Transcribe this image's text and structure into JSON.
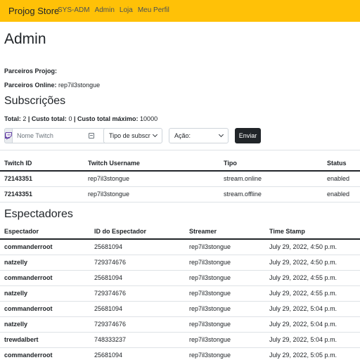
{
  "navbar": {
    "brand": "Projog Store",
    "links": [
      "SYS-ADM",
      "Admin",
      "Loja",
      "Meu Perfil"
    ]
  },
  "page": {
    "title": "Admin"
  },
  "partners": {
    "projog_label": "Parceiros Projog:",
    "online_label": "Parceiros Online:",
    "online_value": "rep7il3stongue"
  },
  "subscriptions": {
    "heading": "Subscrições",
    "total_label": "Total:",
    "total_value": "2",
    "cost_label": "Custo total:",
    "cost_value": "0",
    "max_cost_label": "Custo total máximo:",
    "max_cost_value": "10000",
    "separator": "|",
    "form": {
      "twitch_placeholder": "Nome Twitch",
      "type_select": "Tipo de subscr",
      "action_select": "Ação:",
      "submit_label": "Enviar"
    },
    "table": {
      "headers": [
        "Twitch ID",
        "Twitch Username",
        "Tipo",
        "Status"
      ],
      "rows": [
        [
          "72143351",
          "rep7il3stongue",
          "stream.online",
          "enabled"
        ],
        [
          "72143351",
          "rep7il3stongue",
          "stream.offline",
          "enabled"
        ]
      ]
    }
  },
  "spectators": {
    "heading": "Espectadores",
    "table": {
      "headers": [
        "Espectador",
        "ID do Espectador",
        "Streamer",
        "Time Stamp"
      ],
      "rows": [
        [
          "commanderroot",
          "25681094",
          "rep7il3stongue",
          "July 29, 2022, 4:50 p.m."
        ],
        [
          "natzelly",
          "729374676",
          "rep7il3stongue",
          "July 29, 2022, 4:50 p.m."
        ],
        [
          "commanderroot",
          "25681094",
          "rep7il3stongue",
          "July 29, 2022, 4:55 p.m."
        ],
        [
          "natzelly",
          "729374676",
          "rep7il3stongue",
          "July 29, 2022, 4:55 p.m."
        ],
        [
          "commanderroot",
          "25681094",
          "rep7il3stongue",
          "July 29, 2022, 5:04 p.m."
        ],
        [
          "natzelly",
          "729374676",
          "rep7il3stongue",
          "July 29, 2022, 5:04 p.m."
        ],
        [
          "trewdalbert",
          "748333237",
          "rep7il3stongue",
          "July 29, 2022, 5:04 p.m."
        ],
        [
          "commanderroot",
          "25681094",
          "rep7il3stongue",
          "July 29, 2022, 5:05 p.m."
        ]
      ]
    }
  },
  "icons": {
    "twitch": "twitch-icon",
    "card": "contact-card-icon",
    "select_chevron": "chevron-down-icon"
  },
  "colors": {
    "navbar_bg": "#ffc107",
    "button_bg": "#212529",
    "border": "#dee2e6",
    "twitch_purple": "#6441a5"
  }
}
